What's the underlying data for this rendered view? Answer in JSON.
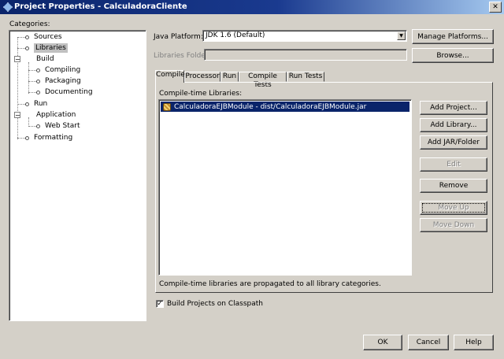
{
  "window": {
    "title": "Project Properties - CalculadoraCliente",
    "close_glyph": "✕"
  },
  "categories": {
    "label": "Categories:",
    "items": [
      {
        "label": "Sources"
      },
      {
        "label": "Libraries",
        "selected": true
      },
      {
        "label": "Build",
        "expander": "−"
      },
      {
        "label": "Compiling"
      },
      {
        "label": "Packaging"
      },
      {
        "label": "Documenting"
      },
      {
        "label": "Run"
      },
      {
        "label": "Application",
        "expander": "−"
      },
      {
        "label": "Web Start"
      },
      {
        "label": "Formatting"
      }
    ]
  },
  "platform": {
    "label": "Java Platform:",
    "value": "JDK 1.6 (Default)",
    "manage_button": "Manage Platforms..."
  },
  "libraries_folder": {
    "label": "Libraries Folder:",
    "value": "",
    "browse_button": "Browse..."
  },
  "tabs": [
    {
      "label": "Compile",
      "active": true
    },
    {
      "label": "Processor"
    },
    {
      "label": "Run"
    },
    {
      "label": "Compile Tests"
    },
    {
      "label": "Run Tests"
    }
  ],
  "compile": {
    "list_label": "Compile-time Libraries:",
    "libraries": [
      {
        "label": "CalculadoraEJBModule - dist/CalculadoraEJBModule.jar",
        "icon": "jar-icon",
        "selected": true
      }
    ],
    "buttons": {
      "add_project": "Add Project...",
      "add_library": "Add Library...",
      "add_jar": "Add JAR/Folder",
      "edit": "Edit",
      "remove": "Remove",
      "move_up": "Move Up",
      "move_down": "Move Down"
    },
    "note": "Compile-time libraries are propagated to all library categories."
  },
  "build_projects": {
    "label": "Build Projects on Classpath",
    "checked": true,
    "check_glyph": "✓"
  },
  "footer": {
    "ok": "OK",
    "cancel": "Cancel",
    "help": "Help"
  },
  "combo_arrow_glyph": "▼"
}
